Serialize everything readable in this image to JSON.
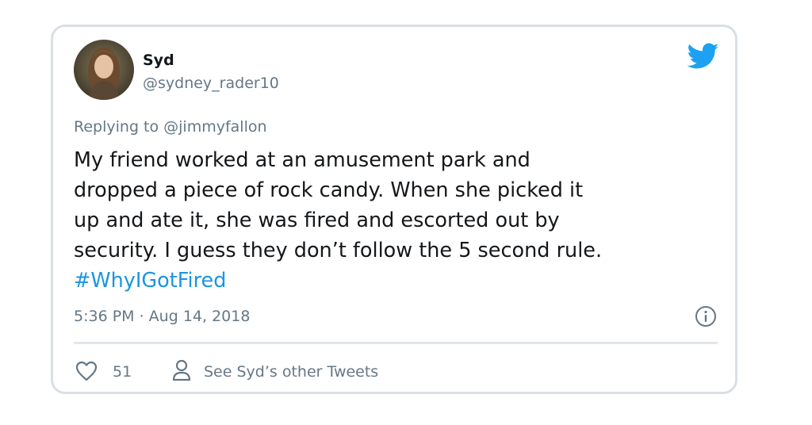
{
  "tweet": {
    "author_name": "Syd",
    "author_handle": "@sydney_rader10",
    "replying_to": "Replying to @jimmyfallon",
    "body_lines": [
      "My friend worked at an amusement park and",
      "dropped a piece of rock candy. When she picked it",
      "up and ate it, she was fired and escorted out by",
      "security. I guess they don’t follow the 5 second rule."
    ],
    "hashtag": "#WhyIGotFired",
    "timestamp": "5:36 PM · Aug 14, 2018",
    "like_count": "51",
    "other_tweets_label": "See Syd’s other Tweets"
  },
  "icons": {
    "brand": "twitter-bird-icon",
    "info": "info-icon",
    "like": "heart-icon",
    "profile": "person-icon"
  },
  "colors": {
    "text_primary": "#14171a",
    "text_secondary": "#657786",
    "link": "#1b95e0",
    "brand_blue": "#1da1f2",
    "border": "#d9dfe4"
  }
}
